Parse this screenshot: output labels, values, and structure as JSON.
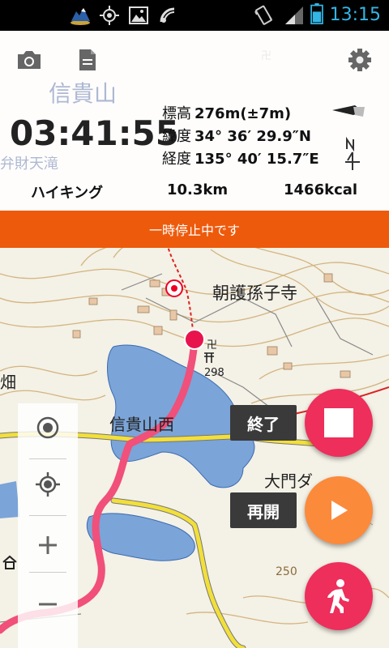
{
  "status_bar": {
    "time": "13:15",
    "icons": [
      "app-notification-icon",
      "gps-icon",
      "image-icon",
      "nfc-icon",
      "vibrate-icon",
      "signal-icon",
      "battery-icon"
    ]
  },
  "toolbar": {
    "camera_icon": "camera-icon",
    "memo_icon": "document-icon",
    "settings_icon": "gear-icon"
  },
  "tracking": {
    "elapsed_time": "03:41:55",
    "elevation_label": "標高",
    "elevation_value": "276m(±7m)",
    "latitude_label": "緯度",
    "latitude_value": "34° 36′ 29.9″N",
    "longitude_label": "経度",
    "longitude_value": "135° 40′ 15.7″E",
    "activity": "ハイキング",
    "distance": "10.3km",
    "calories": "1466kcal"
  },
  "banner": {
    "paused_text": "一時停止中です"
  },
  "map": {
    "labels": {
      "mountain": "信貴山",
      "waterfall": "弁財天滝",
      "temple": "朝護孫子寺",
      "area_west": "信貴山西",
      "fields": "畑",
      "gate": "大門ダ",
      "elev_298": "298",
      "elev_250": "250"
    },
    "colors": {
      "track": "#f0507a",
      "road_yellow": "#f2df3a",
      "water": "#7ba4d8",
      "contour": "#c8a76a"
    }
  },
  "controls": {
    "finish_label": "終了",
    "resume_label": "再開",
    "finish_color": "#ee2e5b",
    "resume_color": "#fb8a3b",
    "walk_color": "#ee2e5b"
  },
  "zoom_panel": {
    "icons": [
      "my-location-icon",
      "gps-fix-icon",
      "zoom-in-icon",
      "zoom-out-icon"
    ]
  }
}
